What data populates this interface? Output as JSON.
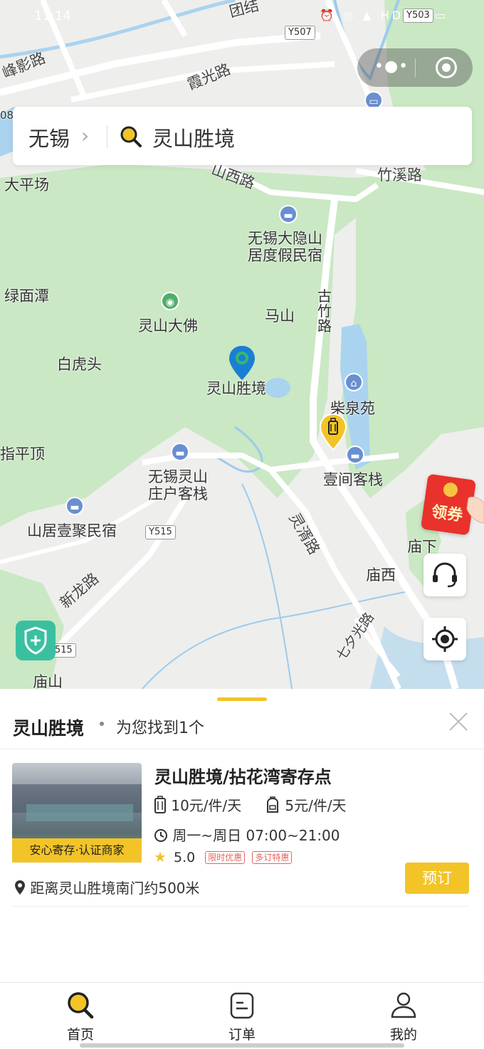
{
  "status_bar": {
    "time": "11:14",
    "icons": "⏰ ◎ ▲ HD ▮▮ ▭"
  },
  "map": {
    "labels": {
      "tuanjie": "团结",
      "fengying": "峰影路",
      "xiaguang": "霞光路",
      "l08": "08",
      "daping": "大平场",
      "shanxi": "山西路",
      "zhuxi": "竹溪路",
      "dayin": "无锡大隐山\n居度假民宿",
      "lvmian": "绿面潭",
      "lingshan_fo": "灵山大佛",
      "mashan": "马山",
      "guzhu": "古\n竹\n路",
      "baihu": "白虎头",
      "lingshan_jing": "灵山胜境",
      "chaiquan": "柴泉苑",
      "zhiping": "指平顶",
      "lingshan_inn": "无锡灵山\n庄户客栈",
      "yijian": "壹间客栈",
      "shanju": "山居壹聚民宿",
      "lingxu": "灵湑路",
      "miaoxia": "庙下",
      "miaoxi": "庙西",
      "xinlong": "新龙路",
      "yunguang": "七夕光路",
      "miaoshan": "庙山"
    },
    "road_signs": {
      "y507": "Y507",
      "y503": "Y503",
      "y515": "Y515",
      "s515": "515"
    }
  },
  "capsule": {
    "more_icon": "more-dots-icon",
    "close_icon": "target-icon"
  },
  "search": {
    "city": "无锡",
    "query": "灵山胜境"
  },
  "coupon": {
    "label": "领券"
  },
  "sheet": {
    "title": "灵山胜境",
    "found_text": "为您找到1个",
    "result": {
      "name": "灵山胜境/拈花湾寄存点",
      "badge": "安心寄存·认证商家",
      "price_luggage": "10元/件/天",
      "price_bag": "5元/件/天",
      "hours": "周一~周日 07:00~21:00",
      "rating": "5.0",
      "tags": [
        "限时优惠",
        "多订特惠"
      ],
      "distance": "距离灵山胜境南门约500米",
      "book_label": "预订"
    }
  },
  "tabs": [
    {
      "label": "首页",
      "icon": "search-icon"
    },
    {
      "label": "订单",
      "icon": "order-icon"
    },
    {
      "label": "我的",
      "icon": "user-icon"
    }
  ],
  "colors": {
    "accent": "#f2c428",
    "map_green": "#c9e8c3",
    "water": "#aad3f0",
    "tag_red": "#e8625a"
  }
}
